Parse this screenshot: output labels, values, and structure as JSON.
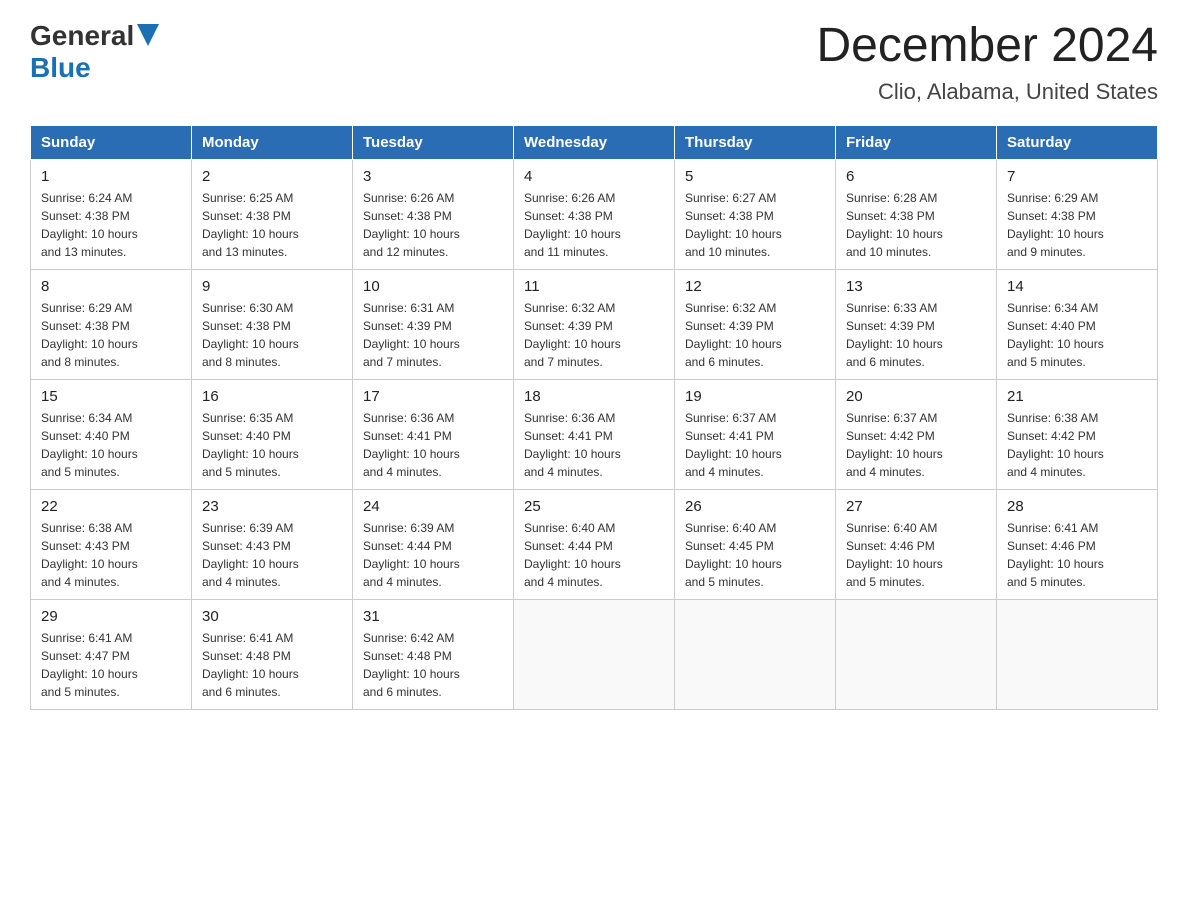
{
  "header": {
    "logo_general": "General",
    "logo_blue": "Blue",
    "month_year": "December 2024",
    "location": "Clio, Alabama, United States"
  },
  "weekdays": [
    "Sunday",
    "Monday",
    "Tuesday",
    "Wednesday",
    "Thursday",
    "Friday",
    "Saturday"
  ],
  "weeks": [
    [
      {
        "day": "1",
        "sunrise": "6:24 AM",
        "sunset": "4:38 PM",
        "daylight": "10 hours and 13 minutes."
      },
      {
        "day": "2",
        "sunrise": "6:25 AM",
        "sunset": "4:38 PM",
        "daylight": "10 hours and 13 minutes."
      },
      {
        "day": "3",
        "sunrise": "6:26 AM",
        "sunset": "4:38 PM",
        "daylight": "10 hours and 12 minutes."
      },
      {
        "day": "4",
        "sunrise": "6:26 AM",
        "sunset": "4:38 PM",
        "daylight": "10 hours and 11 minutes."
      },
      {
        "day": "5",
        "sunrise": "6:27 AM",
        "sunset": "4:38 PM",
        "daylight": "10 hours and 10 minutes."
      },
      {
        "day": "6",
        "sunrise": "6:28 AM",
        "sunset": "4:38 PM",
        "daylight": "10 hours and 10 minutes."
      },
      {
        "day": "7",
        "sunrise": "6:29 AM",
        "sunset": "4:38 PM",
        "daylight": "10 hours and 9 minutes."
      }
    ],
    [
      {
        "day": "8",
        "sunrise": "6:29 AM",
        "sunset": "4:38 PM",
        "daylight": "10 hours and 8 minutes."
      },
      {
        "day": "9",
        "sunrise": "6:30 AM",
        "sunset": "4:38 PM",
        "daylight": "10 hours and 8 minutes."
      },
      {
        "day": "10",
        "sunrise": "6:31 AM",
        "sunset": "4:39 PM",
        "daylight": "10 hours and 7 minutes."
      },
      {
        "day": "11",
        "sunrise": "6:32 AM",
        "sunset": "4:39 PM",
        "daylight": "10 hours and 7 minutes."
      },
      {
        "day": "12",
        "sunrise": "6:32 AM",
        "sunset": "4:39 PM",
        "daylight": "10 hours and 6 minutes."
      },
      {
        "day": "13",
        "sunrise": "6:33 AM",
        "sunset": "4:39 PM",
        "daylight": "10 hours and 6 minutes."
      },
      {
        "day": "14",
        "sunrise": "6:34 AM",
        "sunset": "4:40 PM",
        "daylight": "10 hours and 5 minutes."
      }
    ],
    [
      {
        "day": "15",
        "sunrise": "6:34 AM",
        "sunset": "4:40 PM",
        "daylight": "10 hours and 5 minutes."
      },
      {
        "day": "16",
        "sunrise": "6:35 AM",
        "sunset": "4:40 PM",
        "daylight": "10 hours and 5 minutes."
      },
      {
        "day": "17",
        "sunrise": "6:36 AM",
        "sunset": "4:41 PM",
        "daylight": "10 hours and 4 minutes."
      },
      {
        "day": "18",
        "sunrise": "6:36 AM",
        "sunset": "4:41 PM",
        "daylight": "10 hours and 4 minutes."
      },
      {
        "day": "19",
        "sunrise": "6:37 AM",
        "sunset": "4:41 PM",
        "daylight": "10 hours and 4 minutes."
      },
      {
        "day": "20",
        "sunrise": "6:37 AM",
        "sunset": "4:42 PM",
        "daylight": "10 hours and 4 minutes."
      },
      {
        "day": "21",
        "sunrise": "6:38 AM",
        "sunset": "4:42 PM",
        "daylight": "10 hours and 4 minutes."
      }
    ],
    [
      {
        "day": "22",
        "sunrise": "6:38 AM",
        "sunset": "4:43 PM",
        "daylight": "10 hours and 4 minutes."
      },
      {
        "day": "23",
        "sunrise": "6:39 AM",
        "sunset": "4:43 PM",
        "daylight": "10 hours and 4 minutes."
      },
      {
        "day": "24",
        "sunrise": "6:39 AM",
        "sunset": "4:44 PM",
        "daylight": "10 hours and 4 minutes."
      },
      {
        "day": "25",
        "sunrise": "6:40 AM",
        "sunset": "4:44 PM",
        "daylight": "10 hours and 4 minutes."
      },
      {
        "day": "26",
        "sunrise": "6:40 AM",
        "sunset": "4:45 PM",
        "daylight": "10 hours and 5 minutes."
      },
      {
        "day": "27",
        "sunrise": "6:40 AM",
        "sunset": "4:46 PM",
        "daylight": "10 hours and 5 minutes."
      },
      {
        "day": "28",
        "sunrise": "6:41 AM",
        "sunset": "4:46 PM",
        "daylight": "10 hours and 5 minutes."
      }
    ],
    [
      {
        "day": "29",
        "sunrise": "6:41 AM",
        "sunset": "4:47 PM",
        "daylight": "10 hours and 5 minutes."
      },
      {
        "day": "30",
        "sunrise": "6:41 AM",
        "sunset": "4:48 PM",
        "daylight": "10 hours and 6 minutes."
      },
      {
        "day": "31",
        "sunrise": "6:42 AM",
        "sunset": "4:48 PM",
        "daylight": "10 hours and 6 minutes."
      },
      null,
      null,
      null,
      null
    ]
  ],
  "labels": {
    "sunrise": "Sunrise:",
    "sunset": "Sunset:",
    "daylight": "Daylight:"
  }
}
